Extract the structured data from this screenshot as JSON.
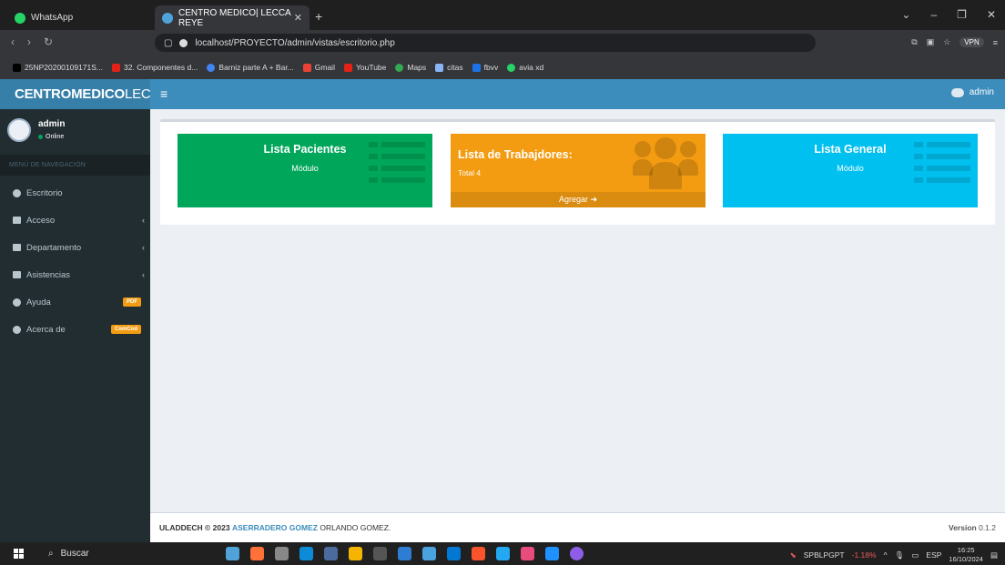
{
  "browser": {
    "tabs": [
      {
        "label": "WhatsApp",
        "active": false
      },
      {
        "label": "CENTRO MEDICO| LECCA REYE",
        "active": true
      }
    ],
    "url": "localhost/PROYECTO/admin/vistas/escritorio.php",
    "vpn_label": "VPN",
    "bookmarks": [
      "25NP20200109171S...",
      "32. Componentes d...",
      "Barniz parte A + Bar...",
      "Gmail",
      "YouTube",
      "Maps",
      "citas",
      "fbvv",
      "avia xd"
    ]
  },
  "header": {
    "logo_bold": "CENTROMEDICO",
    "logo_rest": "LECC",
    "user": "admin"
  },
  "sidebar": {
    "user_name": "admin",
    "user_status": "Online",
    "nav_header": "MENÚ DE NAVEGACIÓN",
    "items": [
      {
        "label": "Escritorio",
        "icon": "dashboard-icon"
      },
      {
        "label": "Acceso",
        "icon": "folder-icon",
        "chevron": true
      },
      {
        "label": "Departamento",
        "icon": "folder-icon",
        "chevron": true
      },
      {
        "label": "Asistencias",
        "icon": "folder-icon",
        "chevron": true
      },
      {
        "label": "Ayuda",
        "icon": "question-icon",
        "badge": "PDF",
        "badge_color": "#f39c12"
      },
      {
        "label": "Acerca de",
        "icon": "info-icon",
        "badge": "ComCod",
        "badge_color": "#f39c12"
      }
    ]
  },
  "boxes": [
    {
      "title": "Lista Pacientes",
      "subtitle": "Módulo",
      "color": "#00a65a"
    },
    {
      "title": "Lista de Trabajdores:",
      "subtitle": "Total 4",
      "footer": "Agregar",
      "color": "#f39c12"
    },
    {
      "title": "Lista General",
      "subtitle": "Módulo",
      "color": "#00c0ef"
    }
  ],
  "footer": {
    "left_bold": "ULADDECH © 2023",
    "link": "ASERRADERO GOMEZ",
    "left_rest": "ORLANDO GOMEZ.",
    "version_label": "Version",
    "version": "0.1.2"
  },
  "taskbar": {
    "search": "Buscar",
    "ticker": "SPBLPGPT",
    "ticker_change": "-1.18%",
    "lang": "ESP",
    "time": "16:25",
    "date": "16/10/2024"
  }
}
